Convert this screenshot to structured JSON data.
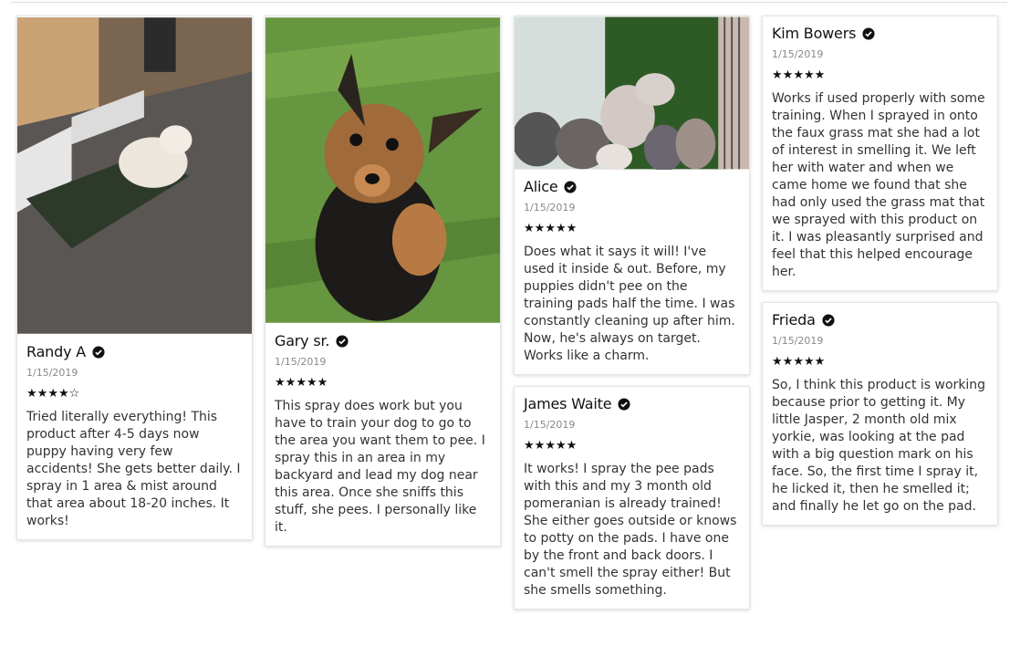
{
  "colors": {
    "text": "#333333",
    "name": "#111111",
    "date": "#888888",
    "star": "#111111"
  },
  "icons": {
    "verified": "verified-check-icon",
    "star": "star-icon"
  },
  "reviews": [
    {
      "name": "Randy A",
      "date": "1/15/2019",
      "rating": 4,
      "text": "Tried literally everything! This product after 4-5 days now puppy having very few accidents! She gets better daily. I spray in 1 area & mist around that area about 18-20 inches. It works!"
    },
    {
      "name": "Gary sr.",
      "date": "1/15/2019",
      "rating": 5,
      "text": "This spray does work but you have to train your dog to go to the area you want them to pee. I spray this in an area in my backyard and lead my dog near this area. Once she sniffs this stuff, she pees. I personally like it."
    },
    {
      "name": "Alice",
      "date": "1/15/2019",
      "rating": 5,
      "text": "Does what it says it will! I've used it inside & out. Before, my puppies didn't pee on the training pads half the time. I was constantly cleaning up after him. Now, he's always on target. Works like a charm."
    },
    {
      "name": "James Waite",
      "date": "1/15/2019",
      "rating": 5,
      "text": "It works! I spray the pee pads with this and my 3 month old pomeranian is already trained! She either goes outside or knows to potty on the pads. I have one by the front and back doors. I can't smell the spray either! But she smells something."
    },
    {
      "name": "Kim Bowers",
      "date": "1/15/2019",
      "rating": 5,
      "text": "Works if used properly with some training. When I sprayed in onto the faux grass mat she had a lot of interest in smelling it. We left her with water and when we came home we found that she had only used the grass mat that we sprayed with this product on it. I was pleasantly surprised and feel that this helped encourage her."
    },
    {
      "name": "Frieda",
      "date": "1/15/2019",
      "rating": 5,
      "text": "So, I think this product is working because prior to getting it. My little Jasper, 2 month old mix yorkie, was looking at the pad with a big question mark on his face. So, the first time I spray it, he licked it, then he smelled it; and finally he let go on the pad."
    }
  ]
}
